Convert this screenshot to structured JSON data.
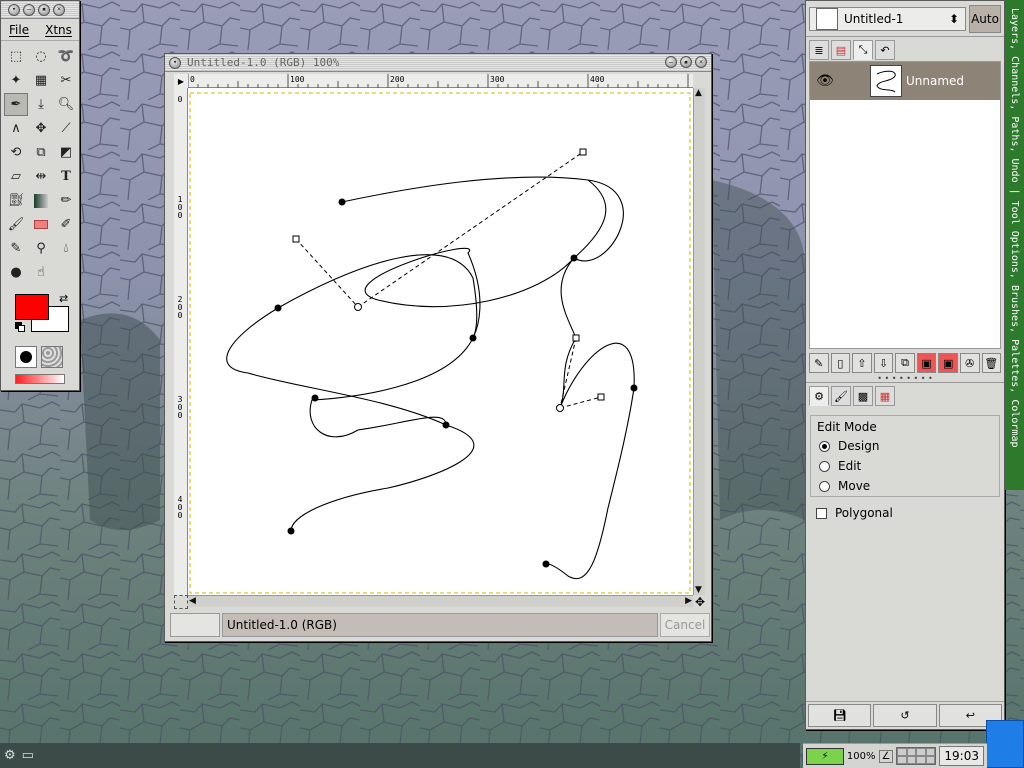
{
  "toolbox": {
    "menu": [
      "File",
      "Xtns"
    ],
    "tools": [
      "rect-select",
      "ellipse-select",
      "lasso",
      "magic-wand",
      "color-select",
      "scissors",
      "paths",
      "color-picker",
      "magnify",
      "measure",
      "move",
      "crop",
      "transform",
      "flip",
      "perspective",
      "text-bbox",
      "align",
      "text",
      "bucket-fill",
      "blend",
      "pencil",
      "paintbrush",
      "eraser",
      "airbrush",
      "ink",
      "clone",
      "convolve",
      "dodge",
      "smudge"
    ],
    "fg_color": "#ff0000",
    "bg_color": "#ffffff"
  },
  "image_window": {
    "title": "Untitled-1.0 (RGB) 100%",
    "ruler_h_labels": [
      "0",
      "100",
      "200",
      "300",
      "400"
    ],
    "ruler_v_labels": [
      "0",
      "100",
      "200",
      "300",
      "400"
    ],
    "status": "Untitled-1.0 (RGB)",
    "cancel_label": "Cancel"
  },
  "dock": {
    "image_name": "Untitled-1",
    "auto_label": "Auto",
    "layer_name": "Unnamed",
    "edit_mode_title": "Edit Mode",
    "modes": [
      "Design",
      "Edit",
      "Move"
    ],
    "selected_mode": "Design",
    "polygonal_label": "Polygonal",
    "side_tabs": "Layers, Channels, Paths, Undo | Tool Options, Brushes, Palettes, Colormap"
  },
  "taskbar": {
    "zoom": "100%",
    "clock": "19:03"
  }
}
